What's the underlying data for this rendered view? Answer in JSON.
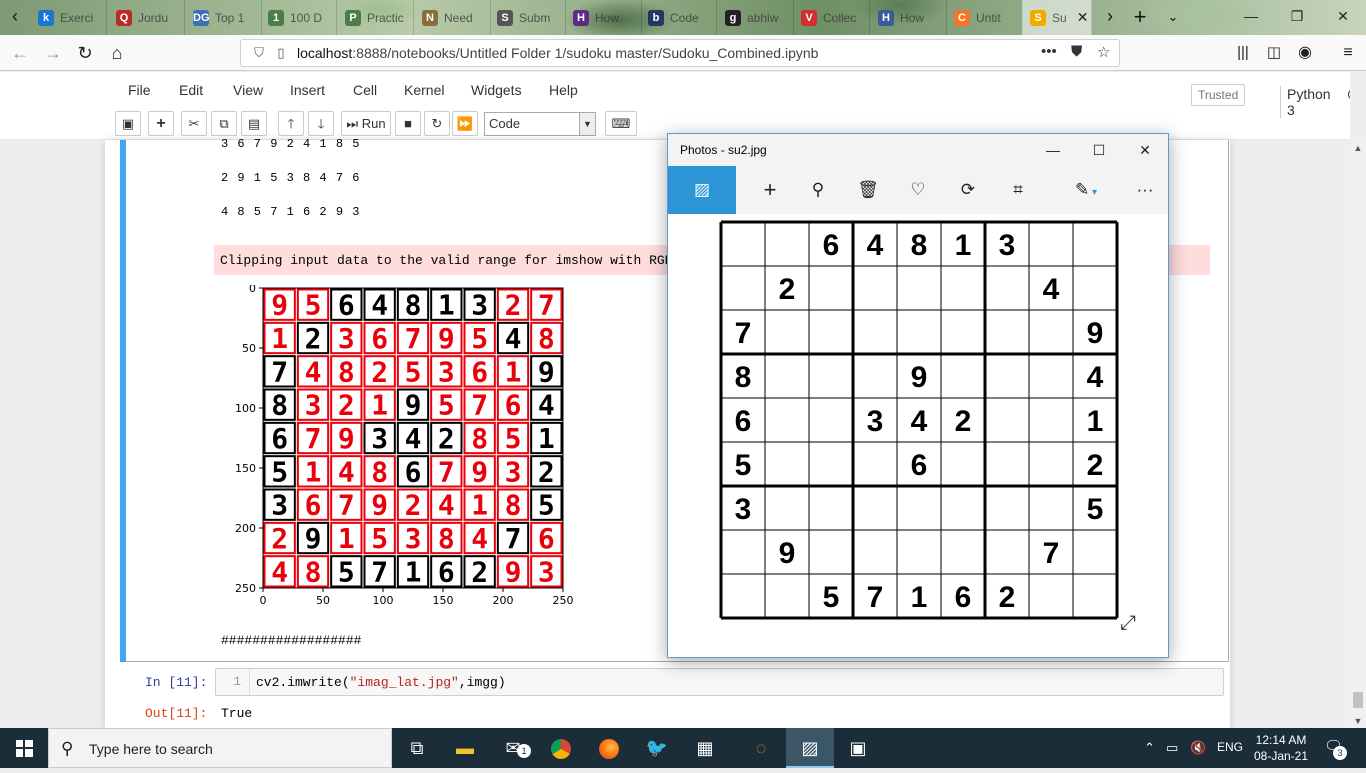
{
  "browser": {
    "tabs": [
      {
        "icon": "k",
        "title": "Exerci",
        "color": "#1976d2"
      },
      {
        "icon": "Q",
        "title": "Jordu",
        "color": "#b92b27"
      },
      {
        "icon": "DG",
        "title": "Top 1",
        "color": "#3a6fb0"
      },
      {
        "icon": "1",
        "title": "100 D",
        "color": "#4a7d4a"
      },
      {
        "icon": "P",
        "title": "Practic",
        "color": "#4a7d4a"
      },
      {
        "icon": "N",
        "title": "Need",
        "color": "#8a6d3b"
      },
      {
        "icon": "S",
        "title": "Subm",
        "color": "#555"
      },
      {
        "icon": "H",
        "title": "How",
        "color": "#5b2c83"
      },
      {
        "icon": "b",
        "title": "Code",
        "color": "#1f3a60"
      },
      {
        "icon": "g",
        "title": "abhiw",
        "color": "#222"
      },
      {
        "icon": "V",
        "title": "Collec",
        "color": "#d32f2f"
      },
      {
        "icon": "H",
        "title": "How",
        "color": "#3a5a99"
      },
      {
        "icon": "C",
        "title": "Untit",
        "color": "#f37626"
      },
      {
        "icon": "S",
        "title": "Su",
        "color": "#f2a900"
      }
    ],
    "url_host": "localhost",
    "url_rest": ":8888/notebooks/Untitled Folder 1/sudoku master/Sudoku_Combined.ipynb"
  },
  "jupyter": {
    "menu": [
      "File",
      "Edit",
      "View",
      "Insert",
      "Cell",
      "Kernel",
      "Widgets",
      "Help"
    ],
    "trusted": "Trusted",
    "kernel": "Python 3",
    "run_label": "Run",
    "cell_type": "Code",
    "output_rows": [
      "3 6 7 9 2 4 1 8 5",
      "2 9 1 5 3 8 4 7 6",
      "4 8 5 7 1 6 2 9 3"
    ],
    "warning": "Clipping input data to the valid range for imshow with RGB data ([0..1] for floats or [0..255] for integers).",
    "hashes": "##################",
    "in_prompt": "In [11]:",
    "line_no": "1",
    "code_pre": "cv2.imwrite(",
    "code_str": "\"imag_lat.jpg\"",
    "code_post": ",imgg)",
    "out_prompt": "Out[11]:",
    "out_value": "True"
  },
  "chart_data": {
    "type": "heatmap",
    "title": "",
    "xlabel": "",
    "ylabel": "",
    "xlim": [
      0,
      250
    ],
    "ylim": [
      250,
      0
    ],
    "xticks": [
      0,
      50,
      100,
      150,
      200,
      250
    ],
    "yticks": [
      0,
      50,
      100,
      150,
      200,
      250
    ],
    "grid_digits": [
      [
        9,
        5,
        6,
        4,
        8,
        1,
        3,
        2,
        7
      ],
      [
        1,
        2,
        3,
        6,
        7,
        9,
        5,
        4,
        8
      ],
      [
        7,
        4,
        8,
        2,
        5,
        3,
        6,
        1,
        9
      ],
      [
        8,
        3,
        2,
        1,
        9,
        5,
        7,
        6,
        4
      ],
      [
        6,
        7,
        9,
        3,
        4,
        2,
        8,
        5,
        1
      ],
      [
        5,
        1,
        4,
        8,
        6,
        7,
        9,
        3,
        2
      ],
      [
        3,
        6,
        7,
        9,
        2,
        4,
        1,
        8,
        5
      ],
      [
        2,
        9,
        1,
        5,
        3,
        8,
        4,
        7,
        6
      ],
      [
        4,
        8,
        5,
        7,
        1,
        6,
        2,
        9,
        3
      ]
    ],
    "given_mask": [
      [
        0,
        0,
        1,
        1,
        1,
        1,
        1,
        0,
        0
      ],
      [
        0,
        1,
        0,
        0,
        0,
        0,
        0,
        1,
        0
      ],
      [
        1,
        0,
        0,
        0,
        0,
        0,
        0,
        0,
        1
      ],
      [
        1,
        0,
        0,
        0,
        1,
        0,
        0,
        0,
        1
      ],
      [
        1,
        0,
        0,
        1,
        1,
        1,
        0,
        0,
        1
      ],
      [
        1,
        0,
        0,
        0,
        1,
        0,
        0,
        0,
        1
      ],
      [
        1,
        0,
        0,
        0,
        0,
        0,
        0,
        0,
        1
      ],
      [
        0,
        1,
        0,
        0,
        0,
        0,
        0,
        1,
        0
      ],
      [
        0,
        0,
        1,
        1,
        1,
        1,
        1,
        0,
        0
      ]
    ],
    "given_color": "#000000",
    "solved_color": "#e8000b"
  },
  "photos": {
    "title": "Photos - su2.jpg",
    "puzzle": [
      [
        0,
        0,
        6,
        4,
        8,
        1,
        3,
        0,
        0
      ],
      [
        0,
        2,
        0,
        0,
        0,
        0,
        0,
        4,
        0
      ],
      [
        7,
        0,
        0,
        0,
        0,
        0,
        0,
        0,
        9
      ],
      [
        8,
        0,
        0,
        0,
        9,
        0,
        0,
        0,
        4
      ],
      [
        6,
        0,
        0,
        3,
        4,
        2,
        0,
        0,
        1
      ],
      [
        5,
        0,
        0,
        0,
        6,
        0,
        0,
        0,
        2
      ],
      [
        3,
        0,
        0,
        0,
        0,
        0,
        0,
        0,
        5
      ],
      [
        0,
        9,
        0,
        0,
        0,
        0,
        0,
        7,
        0
      ],
      [
        0,
        0,
        5,
        7,
        1,
        6,
        2,
        0,
        0
      ]
    ],
    "toolbar_icons": [
      "gallery-icon",
      "add-icon",
      "zoom-icon",
      "delete-icon",
      "favorite-icon",
      "rotate-icon",
      "crop-icon",
      "edit-icon",
      "more-icon"
    ]
  },
  "taskbar": {
    "search_placeholder": "Type here to search",
    "language": "ENG",
    "time": "12:14 AM",
    "date": "08-Jan-21",
    "notifications": "3",
    "mail_badge": "1"
  },
  "colors": {
    "accent": "#42a5f5",
    "photos_accent": "#2b95d6"
  }
}
